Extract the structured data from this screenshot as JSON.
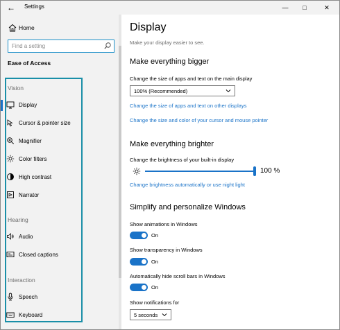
{
  "window": {
    "title": "Settings",
    "back_glyph": "←",
    "minimize_glyph": "—",
    "maximize_glyph": "□",
    "close_glyph": "✕"
  },
  "sidebar": {
    "home_label": "Home",
    "search_placeholder": "Find a setting",
    "section_title": "Ease of Access",
    "groups": {
      "vision": "Vision",
      "hearing": "Hearing",
      "interaction": "Interaction"
    },
    "items": [
      {
        "label": "Display",
        "icon": "monitor-icon",
        "selected": true
      },
      {
        "label": "Cursor & pointer size",
        "icon": "cursor-icon"
      },
      {
        "label": "Magnifier",
        "icon": "magnifier-icon"
      },
      {
        "label": "Color filters",
        "icon": "color-filter-icon"
      },
      {
        "label": "High contrast",
        "icon": "contrast-icon"
      },
      {
        "label": "Narrator",
        "icon": "narrator-icon"
      },
      {
        "label": "Audio",
        "icon": "speaker-icon"
      },
      {
        "label": "Closed captions",
        "icon": "captions-icon"
      },
      {
        "label": "Speech",
        "icon": "microphone-icon"
      },
      {
        "label": "Keyboard",
        "icon": "keyboard-icon"
      }
    ],
    "highlight_color": "#1a8fa8"
  },
  "main": {
    "title": "Display",
    "subtitle": "Make your display easier to see.",
    "bigger": {
      "heading": "Make everything bigger",
      "label": "Change the size of apps and text on the main display",
      "dropdown_value": "100% (Recommended)",
      "link1": "Change the size of apps and text on other displays",
      "link2": "Change the size and color of your cursor and mouse pointer"
    },
    "brighter": {
      "heading": "Make everything brighter",
      "label": "Change the brightness of your built-in display",
      "brightness_value": "100 %",
      "brightness_level": 1.0,
      "link": "Change brightness automatically or use night light"
    },
    "simplify": {
      "heading": "Simplify and personalize Windows",
      "animations_label": "Show animations in Windows",
      "animations_state": "On",
      "transparency_label": "Show transparency in Windows",
      "transparency_state": "On",
      "scrollbars_label": "Automatically hide scroll bars in Windows",
      "scrollbars_state": "On",
      "notifications_label": "Show notifications for",
      "notifications_value": "5 seconds"
    },
    "accent_color": "#1a73c8"
  }
}
